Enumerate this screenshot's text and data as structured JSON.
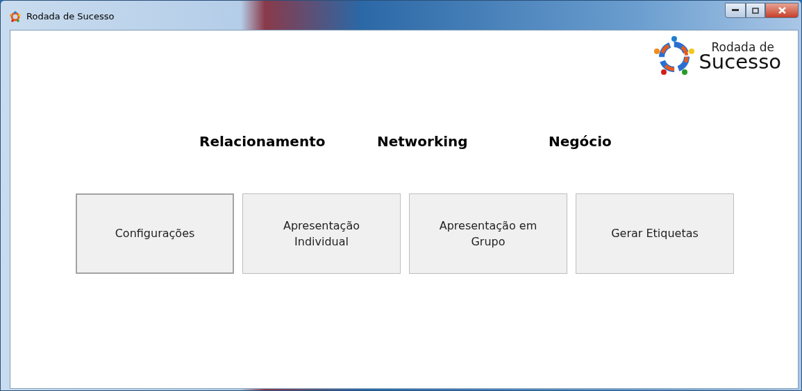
{
  "window": {
    "title": "Rodada de Sucesso"
  },
  "logo": {
    "line_1": "Rodada de",
    "line_2": "Sucesso"
  },
  "headings": [
    "Relacionamento",
    "Networking",
    "Negócio"
  ],
  "buttons": [
    {
      "label": "Configurações",
      "focused": true
    },
    {
      "label": "Apresentação Individual",
      "focused": false
    },
    {
      "label": "Apresentação em Grupo",
      "focused": false
    },
    {
      "label": "Gerar Etiquetas",
      "focused": false
    }
  ]
}
